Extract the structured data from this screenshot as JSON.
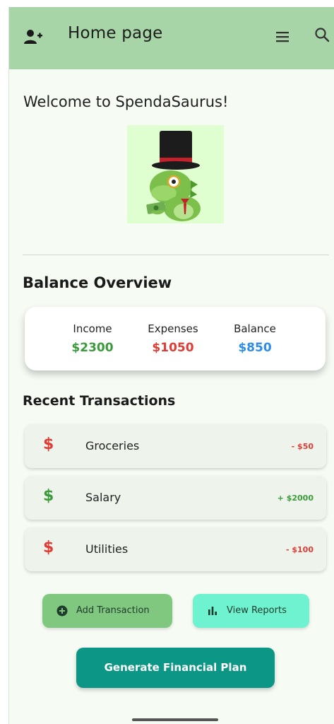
{
  "appbar": {
    "title": "Home page",
    "icons": [
      "add-user-icon",
      "menu-icon",
      "search-icon"
    ]
  },
  "welcome_text": "Welcome to SpendaSaurus!",
  "mascot": {
    "name": "dinosaur-mascot-icon"
  },
  "balance_overview": {
    "title": "Balance Overview",
    "stats": [
      {
        "label": "Income",
        "value": "$2300",
        "color": "#3b9b3b"
      },
      {
        "label": "Expenses",
        "value": "$1050",
        "color": "#e03c36"
      },
      {
        "label": "Balance",
        "value": "$850",
        "color": "#2c8de8"
      }
    ]
  },
  "recent_transactions": {
    "title": "Recent Transactions",
    "items": [
      {
        "icon": "$",
        "name": "Groceries",
        "amount": "- $50",
        "color": "#e03c36"
      },
      {
        "icon": "$",
        "name": "Salary",
        "amount": "+ $2000",
        "color": "#3b9b3b"
      },
      {
        "icon": "$",
        "name": "Utilities",
        "amount": "- $100",
        "color": "#e03c36"
      }
    ]
  },
  "actions": {
    "add_transaction": "Add Transaction",
    "view_reports": "View Reports",
    "generate_plan": "Generate Financial Plan"
  }
}
